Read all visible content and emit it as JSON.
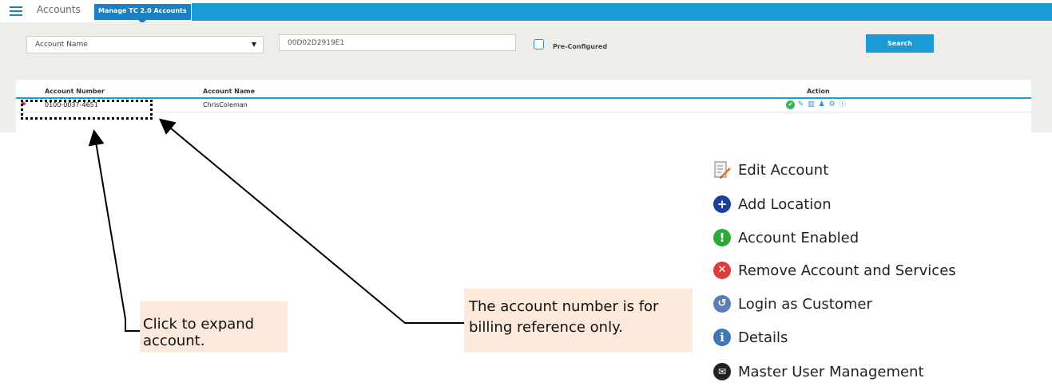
{
  "header": {
    "breadcrumb": "Accounts",
    "active_tab": "Manage TC 2.0 Accounts"
  },
  "filters": {
    "select_value": "Account Name",
    "search_value": "00D02D2919E1",
    "checkbox_label": "Pre-Configured",
    "search_button": "Search"
  },
  "table": {
    "columns": [
      "Account Number",
      "Account Name",
      "Action"
    ],
    "rows": [
      {
        "account_number": "0100-0037-4651",
        "account_name": "ChrisColeman"
      }
    ]
  },
  "callouts": {
    "expand": "Click to expand account.",
    "billing_line1": "The account number is for",
    "billing_line2": "billing reference only."
  },
  "legend": [
    {
      "label": "Edit Account",
      "icon": "edit-account-icon",
      "color": "#6b6b6b"
    },
    {
      "label": "Add Location",
      "icon": "plus-circle-icon",
      "color": "#1e3f9e"
    },
    {
      "label": "Account Enabled",
      "icon": "exclamation-circle-icon",
      "color": "#2fa83a"
    },
    {
      "label": "Remove Account and Services",
      "icon": "x-circle-icon",
      "color": "#e03b3b"
    },
    {
      "label": "Login as Customer",
      "icon": "login-circle-icon",
      "color": "#5a7fb8"
    },
    {
      "label": "Details",
      "icon": "info-circle-icon",
      "color": "#3f78b5"
    },
    {
      "label": "Master User Management",
      "icon": "envelope-circle-icon",
      "color": "#222222"
    }
  ],
  "colors": {
    "accent": "#1b9ad6",
    "panel": "#efedea",
    "callout_bg": "#fbe9dc"
  }
}
